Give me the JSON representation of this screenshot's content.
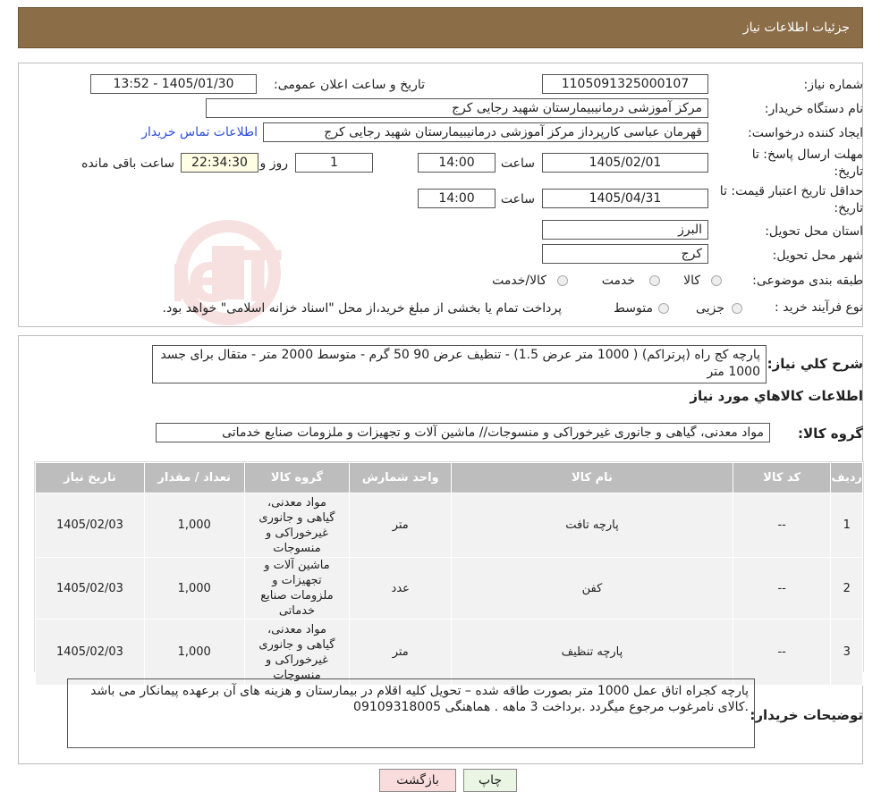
{
  "header": {
    "title": "جزئیات اطلاعات نیاز"
  },
  "form": {
    "need_number_label": "شماره نیاز:",
    "need_number": "1105091325000107",
    "announce_label": "تاریخ و ساعت اعلان عمومی:",
    "announce_value": "1405/01/30 - 13:52",
    "buyer_org_label": "نام دستگاه خریدار:",
    "buyer_org": "مرکز آموزشی درمانیبیمارستان شهید رجایی کرج",
    "creator_label": "ایجاد کننده درخواست:",
    "creator": "قهرمان عباسی کارپرداز مرکز آموزشی درمانیبیمارستان شهید رجایی کرج",
    "contact_link": "اطلاعات تماس خریدار",
    "deadline_label_1": "مهلت ارسال پاسخ: تا",
    "deadline_label_2": "تاریخ:",
    "deadline_date": "1405/02/01",
    "time_label": "ساعت",
    "deadline_time": "14:00",
    "days_value": "1",
    "days_label": "روز و",
    "remaining_time": "22:34:30",
    "remaining_label": "ساعت باقی مانده",
    "validity_label_1": "حداقل تاریخ اعتبار قیمت: تا",
    "validity_label_2": "تاریخ:",
    "validity_date": "1405/04/31",
    "validity_time": "14:00",
    "province_label": "استان محل تحویل:",
    "province": "البرز",
    "city_label": "شهر محل تحویل:",
    "city": "کرج",
    "category_label": "طبقه بندی موضوعی:",
    "category_options": [
      "کالا",
      "خدمت",
      "کالا/خدمت"
    ],
    "process_label": "نوع فرآیند خرید :",
    "process_options": [
      "جزیی",
      "متوسط"
    ],
    "process_note": "پرداخت تمام یا بخشی از مبلغ خرید،از محل \"اسناد خزانه اسلامی\" خواهد بود."
  },
  "summary": {
    "label": "شرح کلي نياز:",
    "text": "پارچه کج راه (پرتراکم)  ( 1000 متر عرض 1.5) -  تنظیف عرض 90  50 گرم - متوسط   2000  متر -  متقال  برای جسد 1000 متر",
    "goods_info_title": "اطلاعات کالاهاي مورد نياز",
    "group_label": "گروه کالا:",
    "group_value": "مواد معدنی، گیاهی و جانوری غیرخوراکی و منسوجات// ماشین آلات و تجهیزات و ملزومات صنایع خدماتی"
  },
  "table": {
    "headers": [
      "ردیف",
      "کد کالا",
      "نام کالا",
      "واحد شمارش",
      "گروه کالا",
      "تعداد / مقدار",
      "تاریخ نیاز"
    ],
    "rows": [
      {
        "index": "1",
        "code": "--",
        "name": "پارچه تافت",
        "unit": "متر",
        "group": "مواد معدنی، گیاهی و جانوری غیرخوراکی و منسوجات",
        "qty": "1,000",
        "date": "1405/02/03"
      },
      {
        "index": "2",
        "code": "--",
        "name": "کفن",
        "unit": "عدد",
        "group": "ماشین آلات و تجهیزات و ملزومات صنایع خدماتی",
        "qty": "1,000",
        "date": "1405/02/03"
      },
      {
        "index": "3",
        "code": "--",
        "name": "پارچه تنظیف",
        "unit": "متر",
        "group": "مواد معدنی، گیاهی و جانوری غیرخوراکی و منسوجات",
        "qty": "1,000",
        "date": "1405/02/03"
      }
    ]
  },
  "buyer_notes": {
    "label": "توضیحات خریدار:",
    "text": "پارچه کجراه اتاق عمل 1000 متر بصورت طاقه  شده – تحویل کلیه اقلام در بیمارستان و هزینه های آن برعهده پیمانکار می باشد .کالای نامرغوب مرجوع میگردد .برداخت 3 ماهه . هماهنگی 09109318005"
  },
  "buttons": {
    "print": "چاپ",
    "back": "بازگشت"
  },
  "watermark": {
    "text": "AriaTender.neT"
  },
  "colors": {
    "header_bg": "#8b6d47",
    "table_header_bg": "#bdbdbd",
    "link": "#2d4fd6",
    "print_btn": "#eaf5e4",
    "back_btn": "#f9dcdc"
  }
}
